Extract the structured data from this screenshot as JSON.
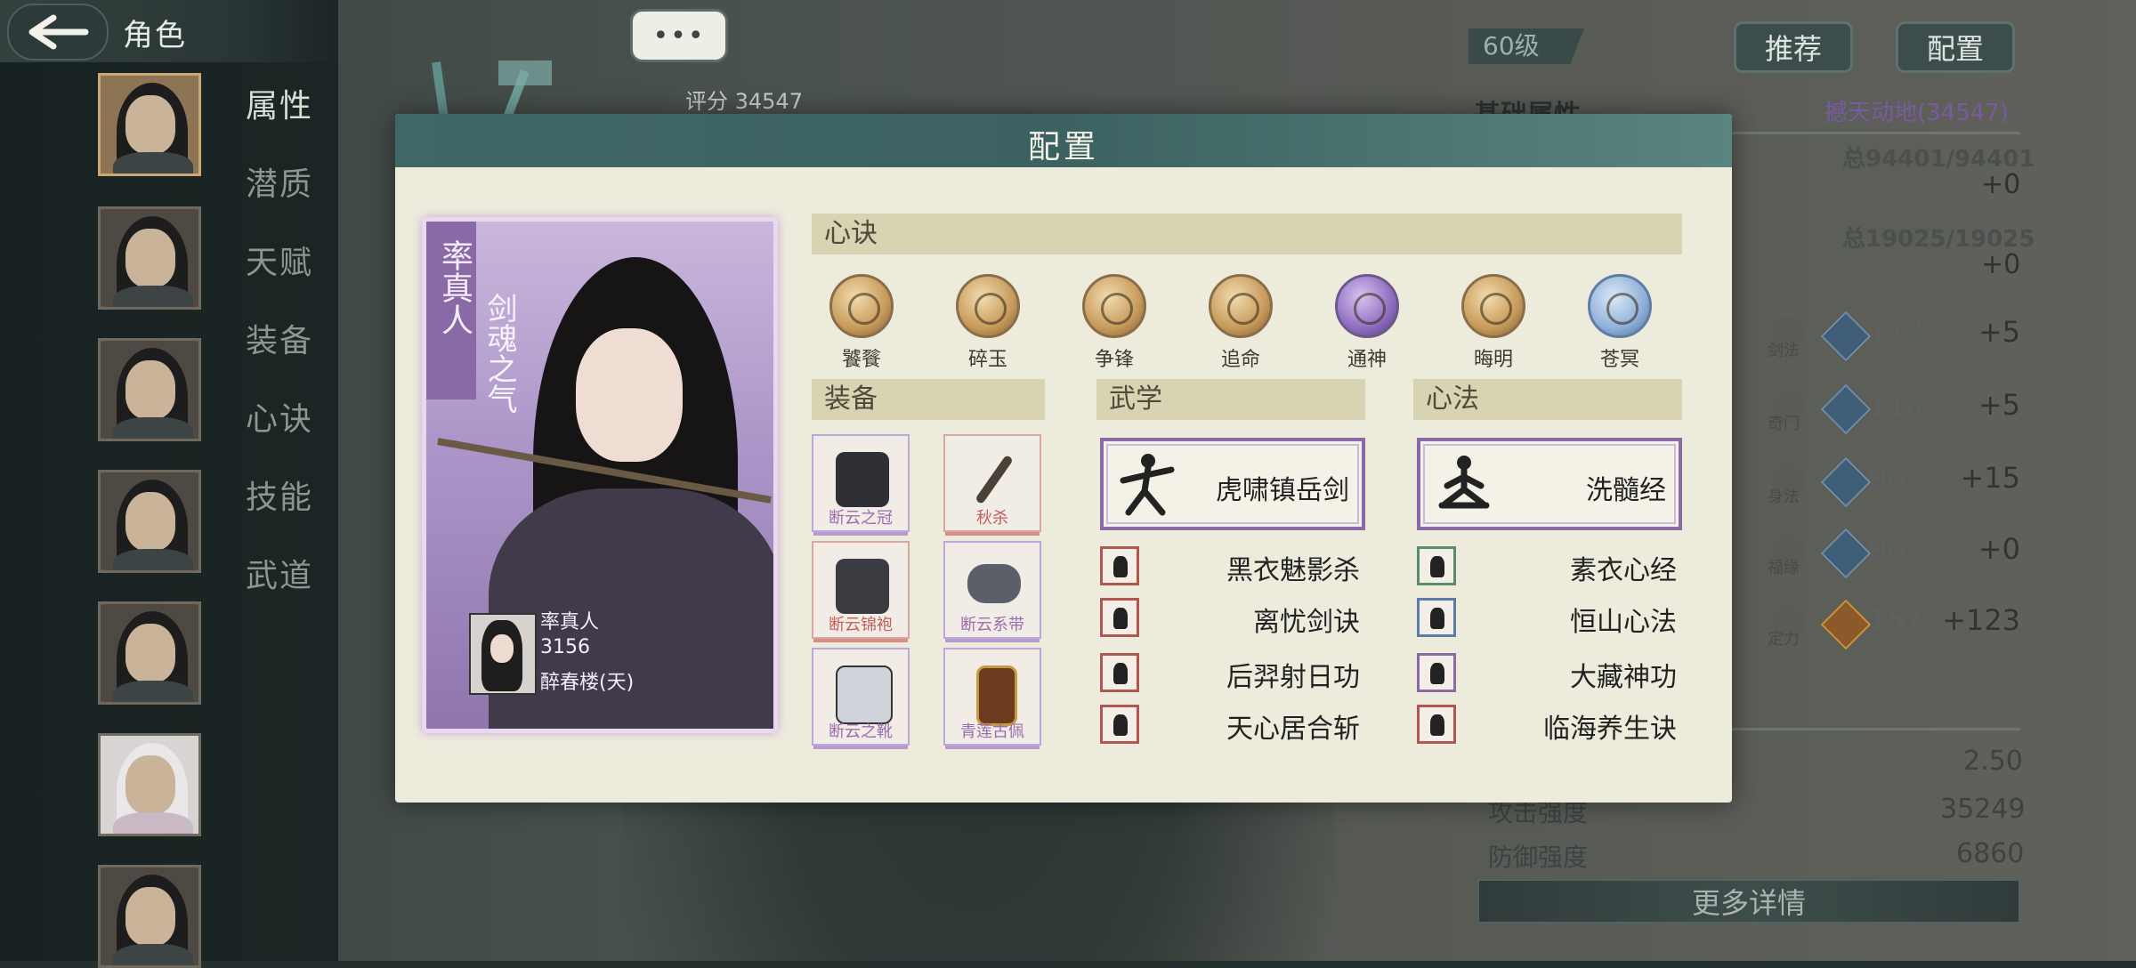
{
  "header": {
    "title": "角色"
  },
  "tabs": [
    {
      "label": "属性",
      "active": true
    },
    {
      "label": "潜质",
      "active": false
    },
    {
      "label": "天赋",
      "active": false
    },
    {
      "label": "装备",
      "active": false
    },
    {
      "label": "心诀",
      "active": false
    },
    {
      "label": "技能",
      "active": false
    },
    {
      "label": "武道",
      "active": false
    }
  ],
  "scene": {
    "more_label": "•••",
    "score_label": "评分 34547"
  },
  "right_panel": {
    "level": "60级",
    "recommend_label": "推荐",
    "config_label": "配置",
    "base_attr_title": "基础属性",
    "power_title": "撼天动地(34547)",
    "total_hp": "总94401/94401",
    "total_hp_bonus": "+0",
    "total_mp": "总19025/19025",
    "total_mp_bonus": "+0",
    "attributes": [
      {
        "label": "剑法",
        "value": "118",
        "bonus": "+5"
      },
      {
        "label": "奇门",
        "value": "118",
        "bonus": "+5"
      },
      {
        "label": "身法",
        "value": "98",
        "bonus": "+15"
      },
      {
        "label": "福缘",
        "value": "98",
        "bonus": "+0"
      },
      {
        "label": "定力",
        "value": "157",
        "bonus": "+123"
      }
    ],
    "stats": [
      {
        "label": "",
        "value": "2.50"
      },
      {
        "label": "攻击强度",
        "value": "35249"
      },
      {
        "label": "防御强度",
        "value": "6860"
      }
    ],
    "more_details": "更多详情"
  },
  "modal": {
    "title": "配置",
    "portrait": {
      "name": "率真人",
      "subtitle": "剑魂之气",
      "info_name": "率真人",
      "info_power": "3156",
      "info_place": "醉春楼(天)"
    },
    "sections": {
      "mind": "心诀",
      "equipment": "装备",
      "martial": "武学",
      "heart": "心法"
    },
    "mind_arts": [
      {
        "label": "饕餮",
        "tone": "gold"
      },
      {
        "label": "碎玉",
        "tone": "gold"
      },
      {
        "label": "争锋",
        "tone": "gold"
      },
      {
        "label": "追命",
        "tone": "gold"
      },
      {
        "label": "通神",
        "tone": "purple"
      },
      {
        "label": "晦明",
        "tone": "gold"
      },
      {
        "label": "苍冥",
        "tone": "blue"
      }
    ],
    "equipment": [
      {
        "label": "断云之冠",
        "tone": "purple"
      },
      {
        "label": "秋杀",
        "tone": "red"
      },
      {
        "label": "断云锦袍",
        "tone": "red"
      },
      {
        "label": "断云系带",
        "tone": "purple"
      },
      {
        "label": "断云之靴",
        "tone": "purple"
      },
      {
        "label": "青莲古佩",
        "tone": "purple"
      }
    ],
    "martial": {
      "main": "虎啸镇岳剑",
      "subs": [
        "黑衣魅影杀",
        "离忧剑诀",
        "后羿射日功",
        "天心居合斩"
      ]
    },
    "heart": {
      "main": "洗髓经",
      "subs": [
        "素衣心经",
        "恒山心法",
        "大藏神功",
        "临海养生诀"
      ]
    }
  }
}
